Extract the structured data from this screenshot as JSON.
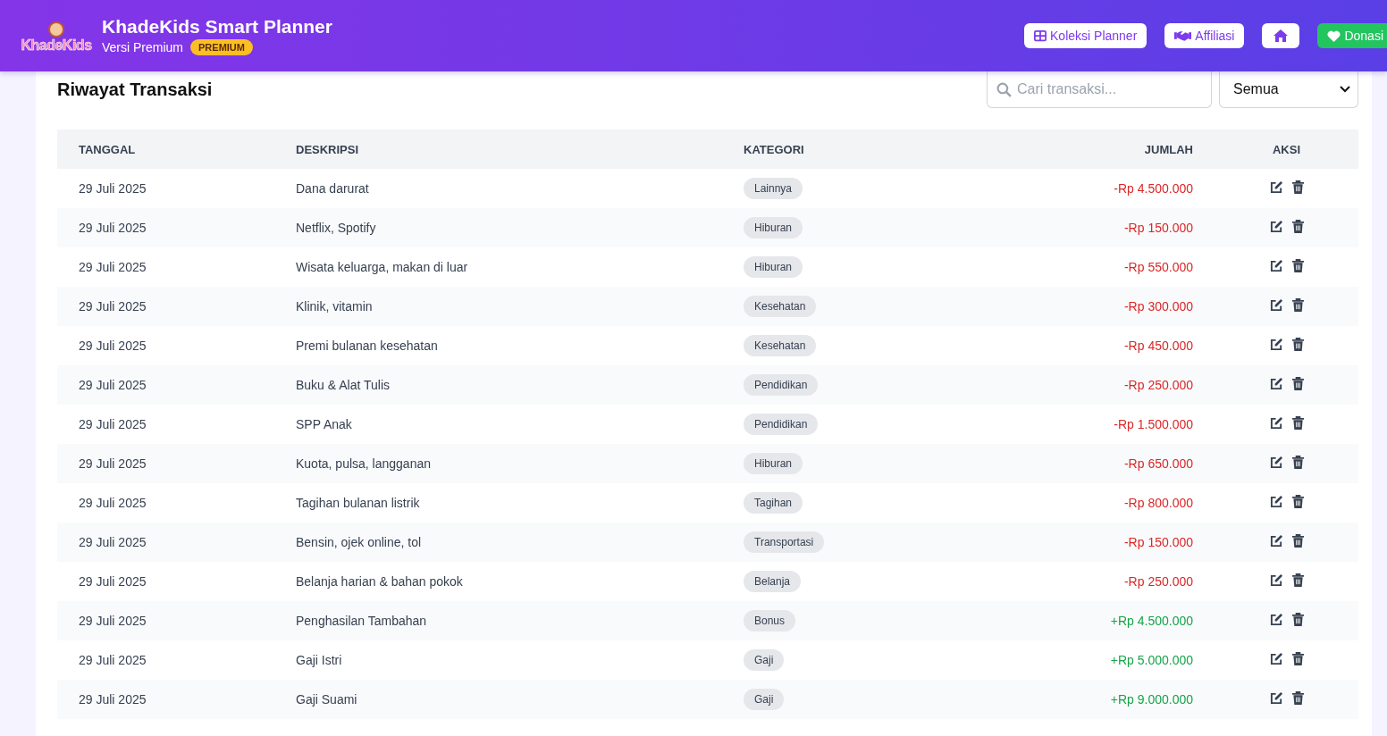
{
  "header": {
    "logo_text": "KhadeKids",
    "title": "KhadeKids Smart Planner",
    "subtitle": "Versi Premium",
    "badge": "PREMIUM",
    "nav": [
      {
        "kind": "grid",
        "label": "Koleksi Planner"
      },
      {
        "kind": "handshake",
        "label": "Affiliasi"
      },
      {
        "kind": "home"
      },
      {
        "kind": "donate",
        "label": "Donasi"
      }
    ]
  },
  "section": {
    "title": "Riwayat Transaksi",
    "search": {
      "placeholder": "Cari transaksi..."
    },
    "filter": {
      "value": "Semua"
    }
  },
  "table": {
    "columns": [
      "TANGGAL",
      "DESKRIPSI",
      "KATEGORI",
      "JUMLAH",
      "AKSI"
    ],
    "rows": [
      {
        "date": "29 Juli 2025",
        "description": "Dana darurat",
        "category": "Lainnya",
        "amount": "-Rp 4.500.000",
        "kind": "expense"
      },
      {
        "date": "29 Juli 2025",
        "description": "Netflix, Spotify",
        "category": "Hiburan",
        "amount": "-Rp 150.000",
        "kind": "expense"
      },
      {
        "date": "29 Juli 2025",
        "description": "Wisata keluarga, makan di luar",
        "category": "Hiburan",
        "amount": "-Rp 550.000",
        "kind": "expense"
      },
      {
        "date": "29 Juli 2025",
        "description": "Klinik, vitamin",
        "category": "Kesehatan",
        "amount": "-Rp 300.000",
        "kind": "expense"
      },
      {
        "date": "29 Juli 2025",
        "description": "Premi bulanan kesehatan",
        "category": "Kesehatan",
        "amount": "-Rp 450.000",
        "kind": "expense"
      },
      {
        "date": "29 Juli 2025",
        "description": "Buku & Alat Tulis",
        "category": "Pendidikan",
        "amount": "-Rp 250.000",
        "kind": "expense"
      },
      {
        "date": "29 Juli 2025",
        "description": "SPP Anak",
        "category": "Pendidikan",
        "amount": "-Rp 1.500.000",
        "kind": "expense"
      },
      {
        "date": "29 Juli 2025",
        "description": "Kuota, pulsa, langganan",
        "category": "Hiburan",
        "amount": "-Rp 650.000",
        "kind": "expense"
      },
      {
        "date": "29 Juli 2025",
        "description": "Tagihan bulanan listrik",
        "category": "Tagihan",
        "amount": "-Rp 800.000",
        "kind": "expense"
      },
      {
        "date": "29 Juli 2025",
        "description": "Bensin, ojek online, tol",
        "category": "Transportasi",
        "amount": "-Rp 150.000",
        "kind": "expense"
      },
      {
        "date": "29 Juli 2025",
        "description": "Belanja harian & bahan pokok",
        "category": "Belanja",
        "amount": "-Rp 250.000",
        "kind": "expense"
      },
      {
        "date": "29 Juli 2025",
        "description": "Penghasilan Tambahan",
        "category": "Bonus",
        "amount": "+Rp 4.500.000",
        "kind": "income"
      },
      {
        "date": "29 Juli 2025",
        "description": "Gaji Istri",
        "category": "Gaji",
        "amount": "+Rp 5.000.000",
        "kind": "income"
      },
      {
        "date": "29 Juli 2025",
        "description": "Gaji Suami",
        "category": "Gaji",
        "amount": "+Rp 9.000.000",
        "kind": "income"
      }
    ]
  }
}
